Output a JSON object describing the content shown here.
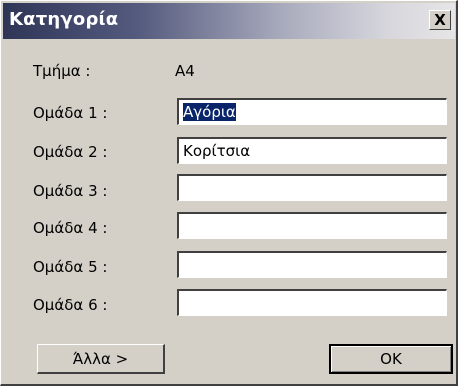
{
  "window": {
    "title": "Κατηγορία",
    "close_glyph": "X"
  },
  "form": {
    "department_label": "Τμήμα :",
    "department_value": "A4",
    "groups": [
      {
        "label": "Ομάδα 1 :",
        "value": "Αγόρια"
      },
      {
        "label": "Ομάδα 2 :",
        "value": "Κορίτσια"
      },
      {
        "label": "Ομάδα 3 :",
        "value": ""
      },
      {
        "label": "Ομάδα 4 :",
        "value": ""
      },
      {
        "label": "Ομάδα 5 :",
        "value": ""
      },
      {
        "label": "Ομάδα 6 :",
        "value": ""
      }
    ]
  },
  "buttons": {
    "more_label": "Άλλα >",
    "ok_label": "OK"
  },
  "colors": {
    "dialog_face": "#d4d0c8",
    "title_gradient_start": "#2e3557",
    "title_gradient_end": "#e6e6e8",
    "selection": "#0a246a"
  }
}
